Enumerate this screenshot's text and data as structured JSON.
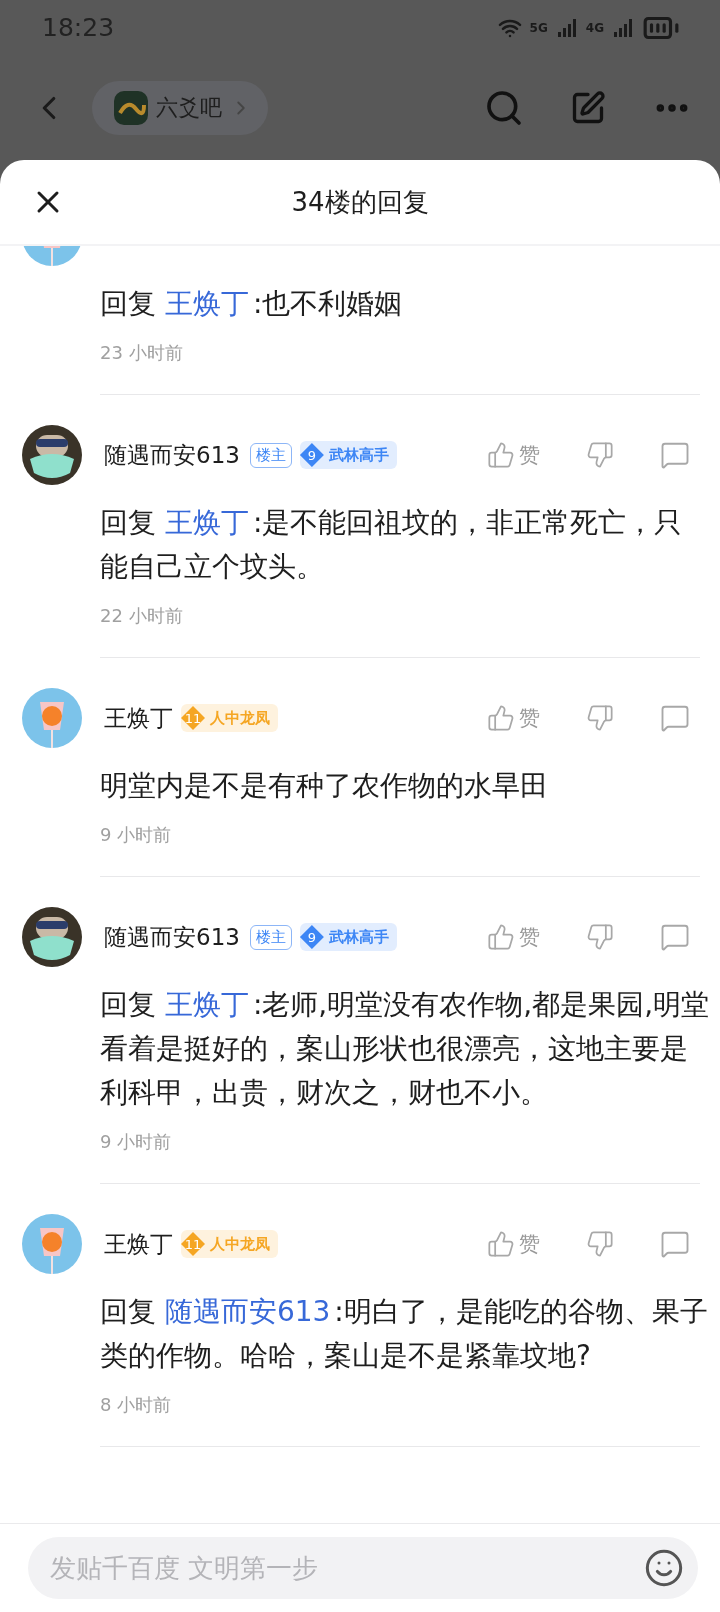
{
  "status_bar": {
    "time": "18:23",
    "network_a": "5G",
    "network_b": "4G"
  },
  "forum_bar": {
    "forum_name": "六爻吧"
  },
  "sheet": {
    "title": "34楼的回复"
  },
  "replies": [
    {
      "kind": "partial",
      "reply_prefix": "回复",
      "reply_to": "王焕丁",
      "text": ":也不利婚姻",
      "time": "23 小时前"
    },
    {
      "kind": "full",
      "user": "随遇而安613",
      "host_badge": "楼主",
      "level": "9",
      "rank": "武林高手",
      "color": "#3d86f5",
      "like_label": "赞",
      "reply_prefix": "回复",
      "reply_to": "王焕丁",
      "text": ":是不能回祖坟的，非正常死亡，只能自己立个坟头。",
      "time": "22 小时前"
    },
    {
      "kind": "full",
      "user": "王焕丁",
      "level": "11",
      "rank": "人中龙凤",
      "color": "#f5a623",
      "like_label": "赞",
      "text": "明堂内是不是有种了农作物的水旱田",
      "time": "9 小时前"
    },
    {
      "kind": "full",
      "user": "随遇而安613",
      "host_badge": "楼主",
      "level": "9",
      "rank": "武林高手",
      "color": "#3d86f5",
      "like_label": "赞",
      "reply_prefix": "回复",
      "reply_to": "王焕丁",
      "text": ":老师,明堂没有农作物,都是果园,明堂看着是挺好的，案山形状也很漂亮，这地主要是利科甲，出贵，财次之，财也不小。",
      "time": "9 小时前"
    },
    {
      "kind": "full",
      "user": "王焕丁",
      "level": "11",
      "rank": "人中龙凤",
      "color": "#f5a623",
      "like_label": "赞",
      "reply_prefix": "回复",
      "reply_to": "随遇而安613",
      "text": ":明白了，是能吃的谷物、果子类的作物。哈哈，案山是不是紧靠坟地?",
      "time": "8 小时前"
    }
  ],
  "composer": {
    "placeholder": "发贴千百度 文明第一步"
  }
}
